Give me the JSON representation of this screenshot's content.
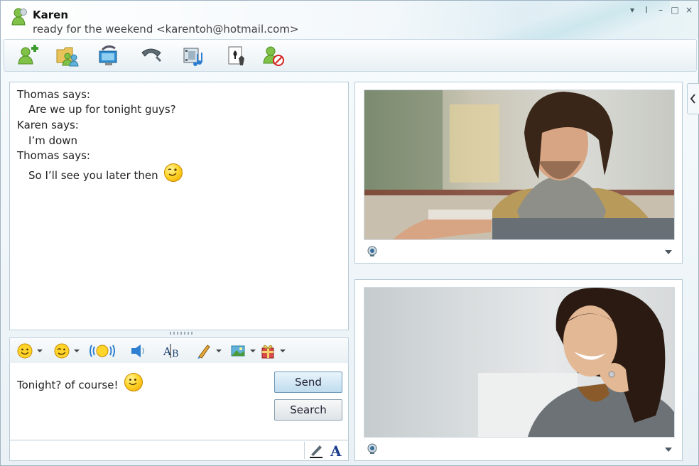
{
  "contact": {
    "name": "Karen",
    "status": "ready for the weekend <karentoh@hotmail.com>"
  },
  "window_controls": [
    "▾",
    "I",
    "–",
    "□",
    "×"
  ],
  "toolbar": {
    "items": [
      {
        "icon": "add-contact-icon"
      },
      {
        "icon": "share-folder-icon"
      },
      {
        "icon": "video-call-icon"
      },
      {
        "icon": "phone-call-icon"
      },
      {
        "icon": "activities-icon"
      },
      {
        "icon": "games-icon"
      },
      {
        "icon": "block-contact-icon"
      }
    ]
  },
  "conversation": [
    {
      "speaker": "Thomas says:",
      "text": "Are we up for tonight guys?"
    },
    {
      "speaker": "Karen says:",
      "text": "I’m down"
    },
    {
      "speaker": "Thomas says:",
      "text": "So I’ll see you later then",
      "emoticon": "wink"
    }
  ],
  "compose": {
    "text": "Tonight? of course!",
    "emoticon": "smile"
  },
  "buttons": {
    "send": "Send",
    "search": "Search"
  },
  "format_bar": [
    {
      "icon": "emoticon-icon",
      "dropdown": true
    },
    {
      "icon": "wink-icon",
      "dropdown": true
    },
    {
      "icon": "nudge-icon",
      "dropdown": false
    },
    {
      "icon": "voice-clip-icon",
      "dropdown": false
    },
    {
      "icon": "font-icon",
      "dropdown": false
    },
    {
      "icon": "handwriting-icon",
      "dropdown": true
    },
    {
      "icon": "background-icon",
      "dropdown": true
    },
    {
      "icon": "gift-icon",
      "dropdown": true
    }
  ],
  "colors": {
    "accent": "#6f98b6",
    "panel_border": "#b9cbd7",
    "background": "#eef4f8"
  }
}
